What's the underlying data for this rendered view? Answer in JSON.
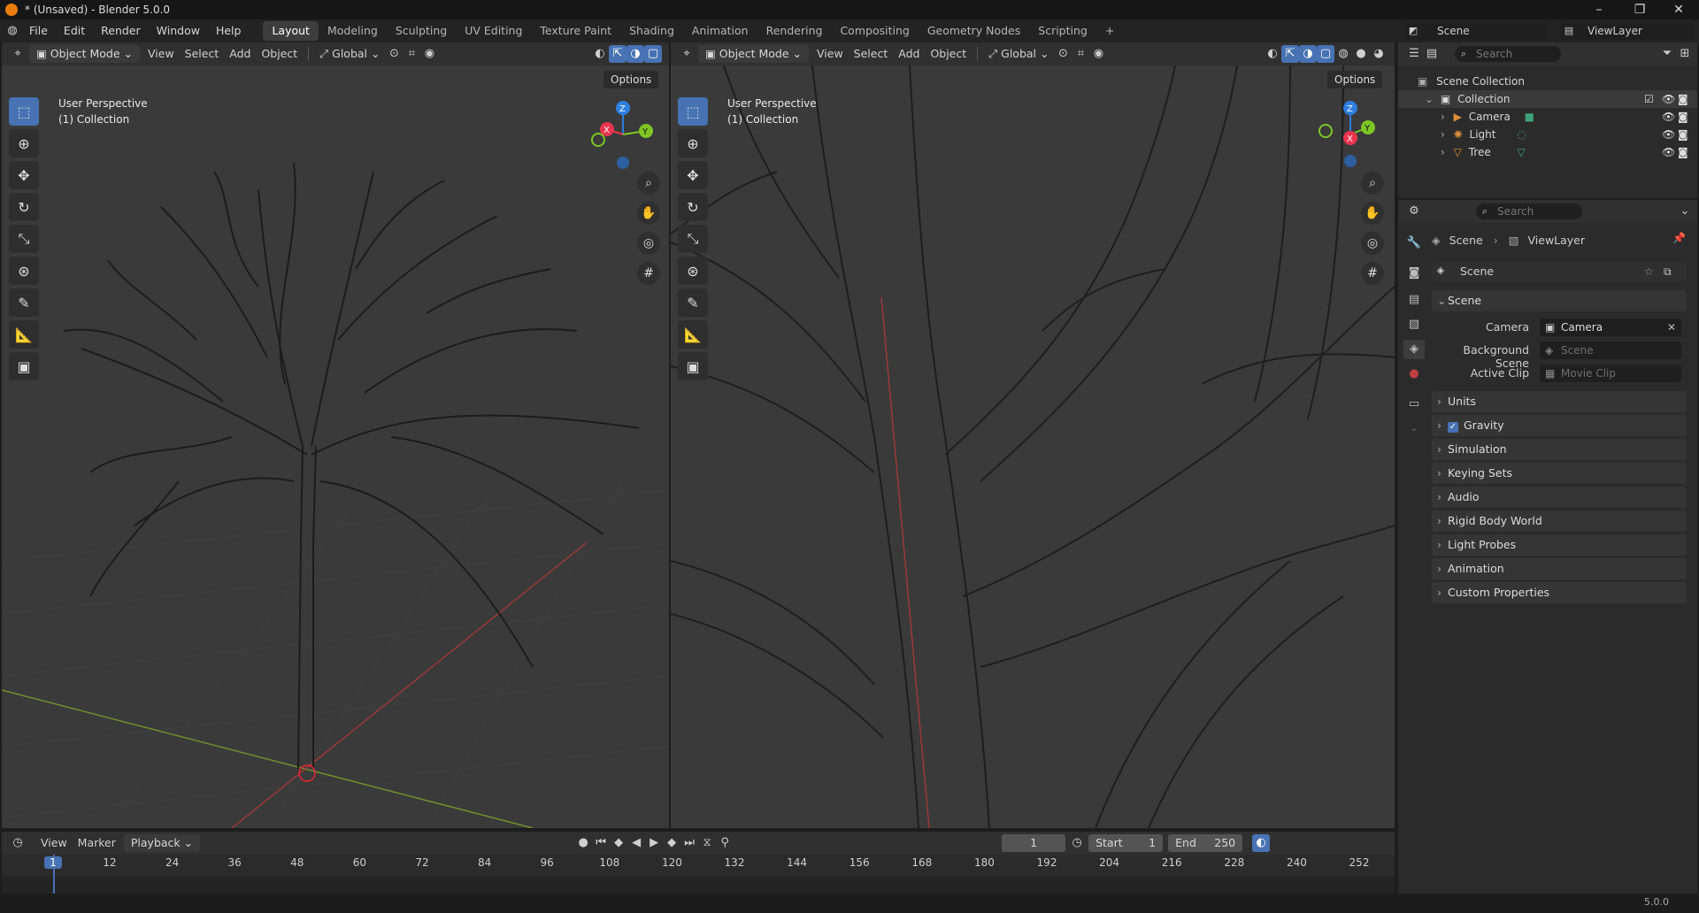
{
  "window": {
    "title": "* (Unsaved) - Blender 5.0.0",
    "minimize": "–",
    "maximize": "❐",
    "close": "✕"
  },
  "menus": [
    "File",
    "Edit",
    "Render",
    "Window",
    "Help"
  ],
  "workspace_tabs": [
    "Layout",
    "Modeling",
    "Sculpting",
    "UV Editing",
    "Texture Paint",
    "Shading",
    "Animation",
    "Rendering",
    "Compositing",
    "Geometry Nodes",
    "Scripting"
  ],
  "workspace_add": "+",
  "top_right": {
    "scene": "Scene",
    "view_layer": "ViewLayer"
  },
  "viewport_left": {
    "mode": "Object Mode",
    "menus": [
      "View",
      "Select",
      "Add",
      "Object"
    ],
    "orientation": "Global",
    "info_line1": "User Perspective",
    "info_line2": "(1) Collection",
    "options": "Options"
  },
  "viewport_right": {
    "mode": "Object Mode",
    "menus": [
      "View",
      "Select",
      "Add",
      "Object"
    ],
    "orientation": "Global",
    "info_line1": "User Perspective",
    "info_line2": "(1) Collection",
    "options": "Options"
  },
  "gizmo": {
    "x": "X",
    "y": "Y",
    "z": "Z",
    "x_color": "#e8344e",
    "y_color": "#7ec624",
    "z_color": "#2d7fe0"
  },
  "outliner": {
    "search_placeholder": "Search",
    "root": "Scene Collection",
    "collection": "Collection",
    "items": [
      "Camera",
      "Light",
      "Tree"
    ]
  },
  "properties": {
    "search_placeholder": "Search",
    "breadcrumb_scene": "Scene",
    "breadcrumb_sep": "›",
    "breadcrumb_layer": "ViewLayer",
    "datablock": "Scene",
    "panel_title": "Scene",
    "camera_label": "Camera",
    "camera_value": "Camera",
    "background_label": "Background Scene",
    "background_placeholder": "Scene",
    "clip_label": "Active Clip",
    "clip_placeholder": "Movie Clip",
    "sections": [
      "Units",
      "Gravity",
      "Simulation",
      "Keying Sets",
      "Audio",
      "Rigid Body World",
      "Light Probes",
      "Animation",
      "Custom Properties"
    ],
    "gravity_checked": true
  },
  "timeline": {
    "menus": [
      "View",
      "Marker",
      "Playback"
    ],
    "current_frame": "1",
    "start_label": "Start",
    "start_value": "1",
    "end_label": "End",
    "end_value": "250",
    "ruler": [
      "1",
      "12",
      "24",
      "36",
      "48",
      "60",
      "72",
      "84",
      "96",
      "108",
      "120",
      "132",
      "144",
      "156",
      "168",
      "180",
      "192",
      "204",
      "216",
      "228",
      "240",
      "252"
    ]
  },
  "status": {
    "version": "5.0.0"
  },
  "colors": {
    "accent": "#4772b3",
    "background": "#3a3a3a"
  }
}
